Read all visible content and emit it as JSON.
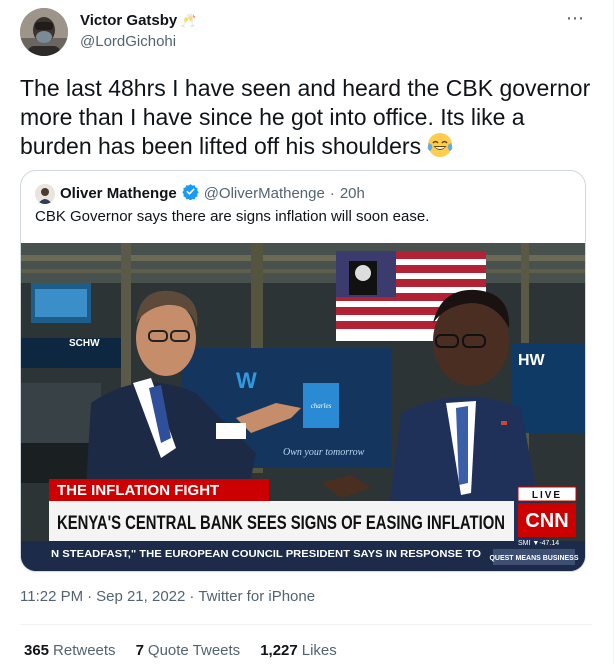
{
  "author": {
    "display_name": "Victor Gatsby",
    "badge_emoji": "🥂",
    "handle": "@LordGichohi"
  },
  "more_icon": "⋯",
  "tweet": {
    "text": "The last 48hrs I have seen and heard the CBK governor more than I have since he got into office. Its like a burden has been lifted off his shoulders",
    "emoji_name": "face-with-tears-of-joy-icon"
  },
  "quote": {
    "display_name": "Oliver Mathenge",
    "handle": "@OliverMathenge",
    "separator": "·",
    "time": "20h",
    "text": "CBK Governor says there are signs inflation will soon ease.",
    "media": {
      "chyron_label": "THE INFLATION FIGHT",
      "headline": "KENYA'S CENTRAL BANK SEES SIGNS OF EASING INFLATION",
      "ticker": "N STEADFAST,\" THE EUROPEAN COUNCIL PRESIDENT SAYS IN RESPONSE TO",
      "live": "LIVE",
      "network": "CNN",
      "market_ticker": "SMI  ▼-47.14",
      "program": "QUEST MEANS BUSINESS",
      "backdrop_left": "SCHW",
      "backdrop_right": "HW",
      "desk_brand": "Own your tomorrow",
      "colors": {
        "chyron_red": "#cc0000",
        "headline_bg": "#f4f4f4",
        "ticker_bg": "#1c2b4a",
        "flag_red": "#b22234",
        "flag_blue": "#3c3b6e"
      }
    }
  },
  "meta": {
    "time": "11:22 PM",
    "separator": "·",
    "date": "Sep 21, 2022",
    "source": "Twitter for iPhone"
  },
  "stats": {
    "retweets_count": "365",
    "retweets_label": "Retweets",
    "quotes_count": "7",
    "quotes_label": "Quote Tweets",
    "likes_count": "1,227",
    "likes_label": "Likes"
  },
  "colors": {
    "text_primary": "#0f1419",
    "text_secondary": "#536471",
    "border": "#cfd9de",
    "verified_blue": "#1d9bf0"
  }
}
